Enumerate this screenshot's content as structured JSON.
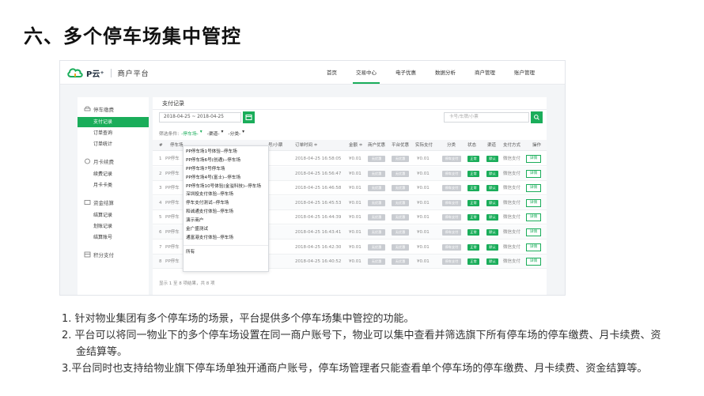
{
  "slide": {
    "title": "六、多个停车场集中管控",
    "notes": [
      "1. 针对物业集团有多个停车场的场景，平台提供多个停车场集中管控的功能。",
      "2. 平台可以将同一物业下的多个停车场设置在同一商户账号下，物业可以集中查看并筛选旗下所有停车场的停车缴费、月卡续费、资",
      "金结算等。",
      "3.平台同时也支持给物业旗下停车场单独开通商户账号，停车场管理者只能查看单个停车场的停车缴费、月卡续费、资金结算等。"
    ]
  },
  "app": {
    "logo_text": "P云⁺",
    "platform_name": "商户平台",
    "brand_color": "#1aad5a",
    "top_nav": [
      {
        "label": "首页",
        "active": false
      },
      {
        "label": "交易中心",
        "active": true
      },
      {
        "label": "电子优惠",
        "active": false
      },
      {
        "label": "数据分析",
        "active": false
      },
      {
        "label": "商户管理",
        "active": false
      },
      {
        "label": "账户管理",
        "active": false
      }
    ],
    "sidebar": {
      "groups": [
        {
          "label": "停车缴费",
          "icon": "car-icon",
          "items": [
            {
              "label": "支付记录",
              "active": true
            },
            {
              "label": "订单查询",
              "active": false
            },
            {
              "label": "订单统计",
              "active": false
            }
          ]
        },
        {
          "label": "月卡续费",
          "icon": "card-icon",
          "items": [
            {
              "label": "续费记录",
              "active": false
            },
            {
              "label": "月卡卡类",
              "active": false
            }
          ]
        },
        {
          "label": "资金结算",
          "icon": "money-icon",
          "items": [
            {
              "label": "结算记录",
              "active": false
            },
            {
              "label": "划账记录",
              "active": false
            },
            {
              "label": "结算账号",
              "active": false
            }
          ]
        },
        {
          "label": "积分支付",
          "icon": "points-icon",
          "items": []
        }
      ]
    },
    "panel": {
      "title": "支付记录",
      "date_range": "2018-04-25 ~ 2018-04-25",
      "search_placeholder": "卡号/车牌/小票",
      "filter_label": "筛选条件:",
      "filters": [
        "-停车场-",
        "-渠道-",
        "-分类-"
      ],
      "table": {
        "headers": [
          "#",
          "停车场",
          "号/小票",
          "订单时间 ≑",
          "金额 ≑",
          "商户优惠",
          "平台优惠",
          "实际支付",
          "分类",
          "状态",
          "渠道",
          "支付方式",
          "操作"
        ],
        "rows": [
          {
            "index": "1",
            "lot": "PP停车",
            "time": "2018-04-25 16:58:05",
            "amount": "¥0.01",
            "merchant_discount": "无优惠",
            "platform_discount": "无优惠",
            "paid": "¥0.01",
            "category": "停车支付",
            "status": "正常",
            "channel": "默认",
            "method": "微信支付",
            "action": "详情"
          },
          {
            "index": "2",
            "lot": "PP停车",
            "time": "2018-04-25 16:56:47",
            "amount": "¥0.01",
            "merchant_discount": "无优惠",
            "platform_discount": "无优惠",
            "paid": "¥0.01",
            "category": "停车支付",
            "status": "正常",
            "channel": "默认",
            "method": "微信支付",
            "action": "详情"
          },
          {
            "index": "3",
            "lot": "PP停车",
            "time": "2018-04-25 16:46:58",
            "amount": "¥0.01",
            "merchant_discount": "无优惠",
            "platform_discount": "无优惠",
            "paid": "¥0.01",
            "category": "停车支付",
            "status": "正常",
            "channel": "默认",
            "method": "微信支付",
            "action": "详情"
          },
          {
            "index": "4",
            "lot": "PP停车",
            "time": "2018-04-25 16:45:53",
            "amount": "¥0.01",
            "merchant_discount": "无优惠",
            "platform_discount": "无优惠",
            "paid": "¥0.01",
            "category": "停车支付",
            "status": "正常",
            "channel": "默认",
            "method": "微信支付",
            "action": "详情"
          },
          {
            "index": "5",
            "lot": "PP停车",
            "time": "2018-04-25 16:44:39",
            "amount": "¥0.01",
            "merchant_discount": "无优惠",
            "platform_discount": "无优惠",
            "paid": "¥0.01",
            "category": "停车支付",
            "status": "正常",
            "channel": "默认",
            "method": "微信支付",
            "action": "详情"
          },
          {
            "index": "6",
            "lot": "PP停车",
            "time": "2018-04-25 16:43:41",
            "amount": "¥0.01",
            "merchant_discount": "无优惠",
            "platform_discount": "无优惠",
            "paid": "¥0.01",
            "category": "停车支付",
            "status": "正常",
            "channel": "默认",
            "method": "微信支付",
            "action": "详情"
          },
          {
            "index": "7",
            "lot": "PP停车",
            "time": "2018-04-25 16:42:30",
            "amount": "¥0.01",
            "merchant_discount": "无优惠",
            "platform_discount": "无优惠",
            "paid": "¥0.01",
            "category": "停车支付",
            "status": "正常",
            "channel": "默认",
            "method": "微信支付",
            "action": "详情"
          },
          {
            "index": "8",
            "lot": "PP停车",
            "time": "2018-04-25 16:40:52",
            "amount": "¥0.01",
            "merchant_discount": "无优惠",
            "platform_discount": "无优惠",
            "paid": "¥0.01",
            "category": "停车支付",
            "status": "正常",
            "channel": "默认",
            "method": "微信支付",
            "action": "详情"
          }
        ]
      },
      "footer": "显示 1 至 8 项结果，共 8 项"
    },
    "lot_dropdown": {
      "options": [
        "PP停车场1号体验--停车场",
        "PP停车场6号(创通)--停车场",
        "PP停车场7号停车场",
        "PP停车场4号(富士)--停车场",
        "PP停车场10号体验(金溢科技)--停车场",
        "深圳投支付体验--停车场",
        "停车支付测试--停车场",
        "和诚通支付体验--停车场",
        "演示商户",
        "金广盛测试",
        "通富港支付体验--停车场"
      ],
      "all_option": "所有"
    }
  }
}
